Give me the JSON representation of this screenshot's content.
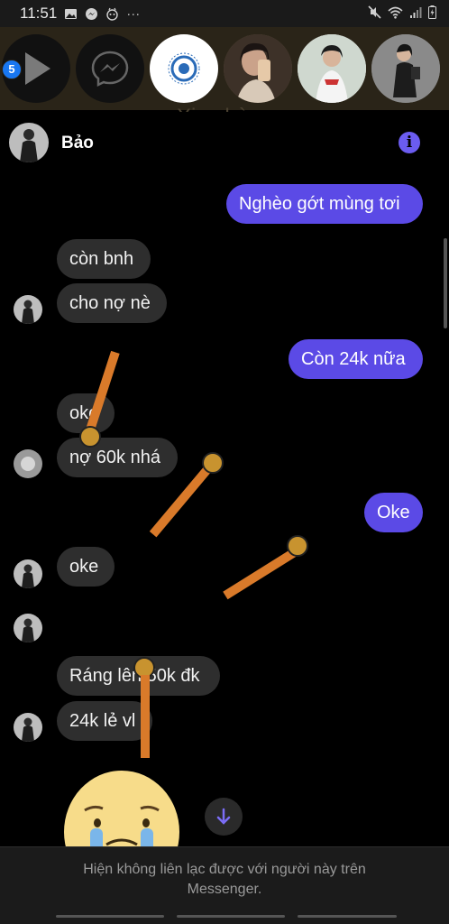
{
  "status_bar": {
    "time": "11:51",
    "left_icons": [
      "image-icon",
      "messenger-icon",
      "bot-icon"
    ],
    "overflow": "···",
    "right_icons": [
      "mute-icon",
      "wifi-icon",
      "signal-icon",
      "battery-icon"
    ]
  },
  "chat_heads": {
    "unread_badge": "5",
    "items": [
      "play-chat-head",
      "messenger-chat-head",
      "logo-chat-head",
      "photo-chat-head-1",
      "photo-chat-head-2",
      "photo-chat-head-3"
    ],
    "background_text": "Xin chào"
  },
  "conversation": {
    "contact_name": "Bảo",
    "info_icon": "info-icon",
    "messages": [
      {
        "side": "out",
        "text": "Nghèo gớt mùng tơi"
      },
      {
        "side": "in",
        "text": "còn bnh"
      },
      {
        "side": "in",
        "text": "cho nợ nè"
      },
      {
        "side": "out",
        "text": "Còn 24k nữa"
      },
      {
        "side": "in",
        "text": "oke"
      },
      {
        "side": "in",
        "text": "nợ 60k nhá"
      },
      {
        "side": "out",
        "text": "Oke"
      },
      {
        "side": "in",
        "text": "oke"
      },
      {
        "side": "in",
        "text": "Ráng lên 50k đk"
      },
      {
        "side": "in",
        "text": "24k lẻ vl"
      }
    ],
    "sticker": "crying-face-sticker",
    "scroll_down_icon": "arrow-down-icon"
  },
  "footer": {
    "notice": "Hiện không liên lạc được với người này trên\nMessenger."
  },
  "colors": {
    "outgoing_bubble": "#5b4ae6",
    "incoming_bubble": "#2e2e2e",
    "accent": "#6b5cf0"
  }
}
